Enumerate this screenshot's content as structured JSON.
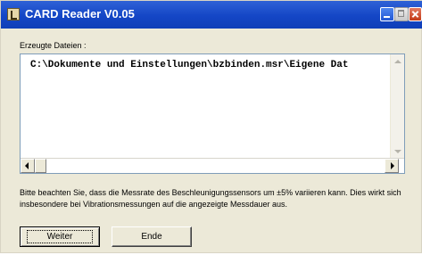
{
  "window": {
    "title": "CARD Reader  V0.05"
  },
  "files": {
    "label": "Erzeugte Dateien :",
    "value": "C:\\Dokumente und Einstellungen\\bzbinden.msr\\Eigene Dat"
  },
  "note": "Bitte beachten Sie, dass die Messrate des Beschleunigungssensors um ±5% variieren kann. Dies wirkt sich insbesondere bei Vibrationsmessungen auf die angezeigte Messdauer aus.",
  "buttons": {
    "weiter": "Weiter",
    "ende": "Ende"
  },
  "icons": {
    "app": "card-reader-icon",
    "minimize": "minimize-icon",
    "maximize": "maximize-icon",
    "close": "close-icon"
  }
}
